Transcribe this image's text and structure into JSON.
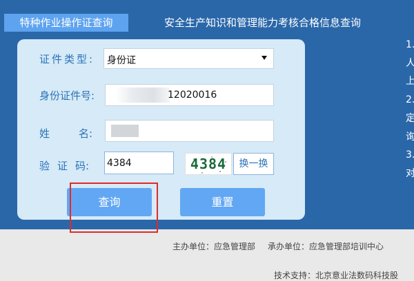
{
  "tabs": [
    {
      "label": "特种作业操作证查询"
    },
    {
      "label": "安全生产知识和管理能力考核合格信息查询"
    }
  ],
  "side_text": "1.\n人\n上\n2.\n定\n询\n3.\n对",
  "form": {
    "type_label": "证件类型:",
    "type_value": "身份证",
    "id_label": "身份证件号:",
    "id_value": "12020016",
    "name_label_1": "姓",
    "name_label_2": "名:",
    "code_label_1": "验",
    "code_label_2": "证",
    "code_label_3": "码:",
    "code_value": "4384",
    "captcha_text": "4384",
    "change_label": "换一换"
  },
  "buttons": {
    "query": "查询",
    "reset": "重置"
  },
  "footer": {
    "host": "主办单位：应急管理部",
    "organizer": "承办单位：应急管理部培训中心",
    "support": "技术支持：北京意业法数码科技股"
  },
  "colors": {
    "band": "#2a67a9",
    "active_tab": "#5ea3ef",
    "panel": "#d6eaf7",
    "button": "#62a7f3",
    "highlight": "#e02a2a"
  }
}
